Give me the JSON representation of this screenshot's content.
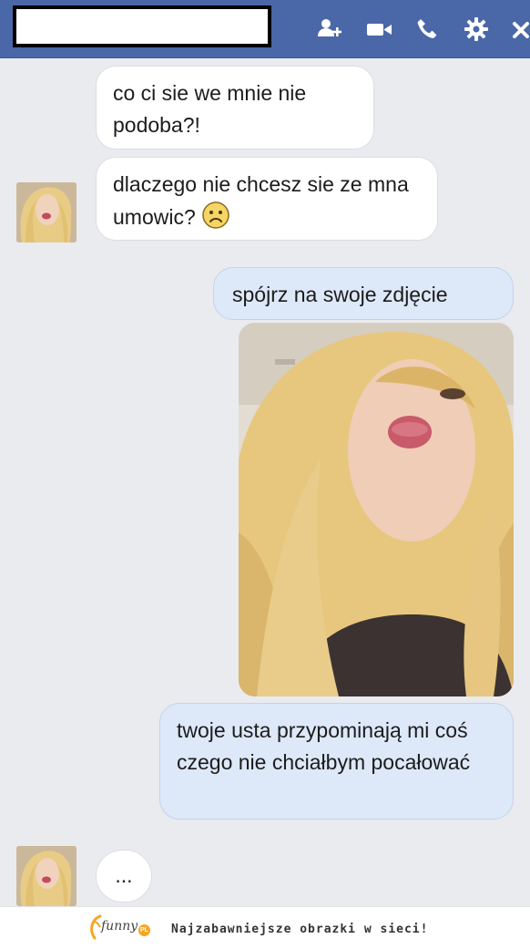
{
  "header": {
    "contact_name": "",
    "icons": [
      "add-friend-icon",
      "video-call-icon",
      "phone-call-icon",
      "settings-gear-icon",
      "close-icon"
    ]
  },
  "messages": [
    {
      "from": "them",
      "text": "co ci sie we mnie nie podoba?!"
    },
    {
      "from": "them",
      "text": "dlaczego nie chcesz sie ze mna umowic?",
      "emoji": "frown-emoji"
    },
    {
      "from": "me",
      "text": "spójrz na swoje zdjęcie"
    },
    {
      "from": "me",
      "type": "photo",
      "image": "selfie-photo"
    },
    {
      "from": "me",
      "text": "twoje usta przypominają mi coś czego nie chciałbym pocałować"
    },
    {
      "from": "them",
      "text": "..."
    }
  ],
  "footer": {
    "logo_text": "funny",
    "logo_badge": "PL",
    "tagline": "Najzabawniejsze obrazki w sieci!"
  },
  "colors": {
    "header_bg": "#4a67a8",
    "chat_bg": "#eaebef",
    "incoming_bubble": "#ffffff",
    "outgoing_bubble": "#dde8f8",
    "logo_accent": "#f5a623"
  }
}
